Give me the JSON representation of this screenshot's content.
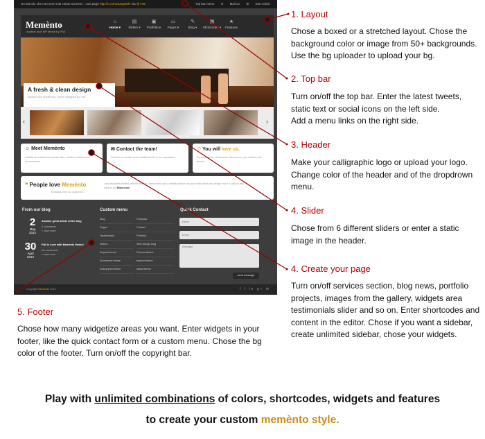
{
  "screenshot": {
    "topbar": {
      "left_text": "Un articolo che non avrei mai voluto scrivere... cosi pagò",
      "left_link": "http://t.co/AE2aQpMhr",
      "left_via": "via",
      "left_user": "@YIW",
      "menu": [
        "Top bar menu",
        "Mail us",
        "Site Admin"
      ]
    },
    "header": {
      "logo": "Memènto",
      "tagline": "Another nice WP theme by YIW",
      "nav": [
        "Home",
        "Sliders",
        "Portfolio",
        "Pages",
        "Blog",
        "Shortcodes",
        "Features"
      ]
    },
    "slider": {
      "caption_title": "A fresh & clean design",
      "caption_sub": "another nice WordPress Theme designed by YIW",
      "prev": "‹",
      "next": "›"
    },
    "services": [
      {
        "pre": "",
        "title": "Meet Memènto",
        "post": "",
        "text": "suitable for business/corporate sites, creative portfolio and personal sites."
      },
      {
        "pre": "",
        "title": "Contact the team!",
        "post": "",
        "text": "Feel free to contact us for additional info or for a quotation!"
      },
      {
        "pre": "You will ",
        "title": "love us.",
        "post": "",
        "text": "Try the features of Memènto. We are sure you will love this theme!"
      }
    ],
    "testimonial": {
      "title_pre": "People love ",
      "title_hl": "Memènto",
      "subtitle": "feedback from our customers",
      "quote": "I am absolutely thrilled with this theme! I have never built a website before but your instructions and design make it look fun and easy to do!",
      "read_more": "Read more"
    },
    "footer": {
      "blog_title": "From our blog",
      "posts": [
        {
          "day": "2",
          "month": "May",
          "year": "2012",
          "title": "Another great article of the blog",
          "comments": "2 comments",
          "more": "» read more"
        },
        {
          "day": "30",
          "month": "April",
          "year": "2012",
          "title": "Fall in Love with Memènto theme!",
          "comments": "No comments",
          "more": "» read more"
        }
      ],
      "menu_title": "Custom menu",
      "menu_col1": [
        "Blog",
        "Pages",
        "Testimonials",
        "Sliders",
        "Support forum",
        "Sommerce theme",
        "Kassyopea theme"
      ],
      "menu_col2": [
        "Features",
        "Contact",
        "Portfolio",
        "Web design blog",
        "Diverso theme",
        "Impero theme",
        "Maya theme"
      ],
      "contact_title": "Quick Contact",
      "name_ph": "Name",
      "email_ph": "Email",
      "message_ph": "Message",
      "send": "send message",
      "copyright_pre": "Copyright ",
      "copyright_hl": "Memènto",
      "copyright_post": " 2012"
    }
  },
  "annotations": [
    {
      "title": "1. Layout",
      "text": [
        "Chose a boxed or a stretched layout. Chose the",
        "background color or image from 50+ backgrounds.",
        "Use the bg uploader to upload your bg."
      ]
    },
    {
      "title": "2. Top bar",
      "text": [
        "Turn on/off the top bar. Enter the latest tweets,",
        "static text or social icons on the left side.",
        "Add a menu links on the right side."
      ]
    },
    {
      "title": "3. Header",
      "text": [
        "Make your calligraphic logo or upload your logo.",
        "Change color of the header and of the dropdrown",
        "menu."
      ]
    },
    {
      "title": "4. Slider",
      "text": [
        "Chose from 6 different sliders or enter a static",
        "image in the header."
      ]
    },
    {
      "title": "4. Create your page",
      "text": [
        "Turn on/off services section, blog news, portfolio",
        "projects, images from the gallery, widgets area",
        "testimonials slider and so on. Enter shortcodes and",
        "content in the editor. Chose if you want a sidebar,",
        "create unlimited sidebar, chose your widgets."
      ]
    },
    {
      "title": "5. Footer",
      "text": [
        "Chose how many widgetize areas you want. Enter widgets in your",
        "footer, like the quick contact form or a custom menu. Chose the bg",
        "color of the footer. Turn on/off the copyright bar."
      ]
    }
  ],
  "bottom": {
    "line1_pre": "Play with ",
    "line1_ul": "unlimited combinations",
    "line1_post": " of colors, shortcodes, widgets and features",
    "line2_pre": "to create your custom ",
    "line2_hl": "memènto style."
  },
  "colors": {
    "accent": "#d9a21b",
    "annotation": "#b90000",
    "line": "#9a0000"
  }
}
